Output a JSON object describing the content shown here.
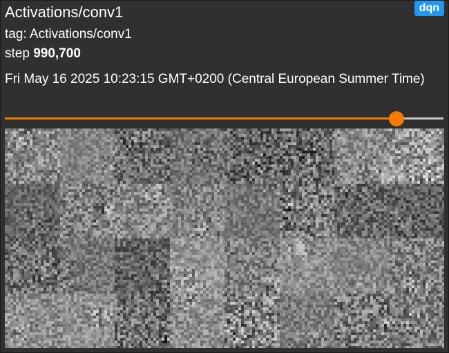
{
  "card": {
    "title": "Activations/conv1",
    "run_badge": "dqn",
    "tag_label": "tag: ",
    "tag_value": "Activations/conv1",
    "step_label": "step ",
    "step_value": "990,700",
    "timestamp": "Fri May 16 2025 10:23:15 GMT+0200 (Central European Summer Time)"
  },
  "step_slider": {
    "fraction": 0.893
  },
  "activation_image": {
    "grid_rows": 4,
    "grid_cols": 8,
    "colormap": "grayscale"
  },
  "colors": {
    "card_background": "#303030",
    "badge": "#2196f3",
    "slider_accent": "#f57c00",
    "slider_track": "#c9c9c9"
  }
}
